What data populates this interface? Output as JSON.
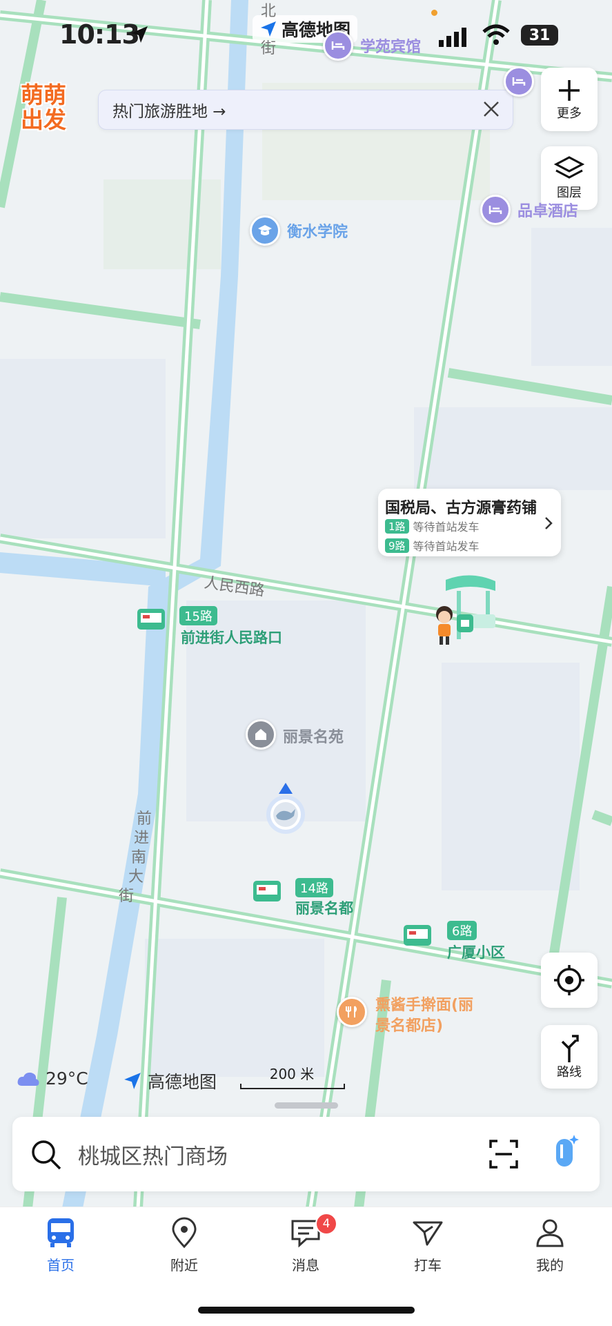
{
  "status_bar": {
    "time": "10:13",
    "app_name": "高德地图",
    "battery": "31"
  },
  "banner": {
    "logo_line1": "萌萌",
    "logo_line2": "出发",
    "text": "热门旅游胜地 →"
  },
  "side_buttons": {
    "more": "更多",
    "layers": "图层",
    "route": "路线"
  },
  "map": {
    "north_label": "北",
    "street_label": "街",
    "pois": [
      {
        "name": "学苑宾馆",
        "color": "#9b8ee0"
      },
      {
        "name": "品卓酒店",
        "color": "#9b8ee0"
      },
      {
        "name": "衡水学院",
        "color": "#6aa3e8"
      },
      {
        "name": "丽景名苑",
        "color": "#8a8f99"
      },
      {
        "name": "熏酱手擀面(丽",
        "color": "#f2a060"
      },
      {
        "name": "景名都店)",
        "color": "#f2a060"
      }
    ],
    "roads": [
      "人民西路",
      "前",
      "进",
      "南",
      "大",
      "街"
    ],
    "bus_stops": [
      {
        "route": "15路",
        "name": "前进街人民路口"
      },
      {
        "route": "14路",
        "name": "丽景名都"
      },
      {
        "route": "6路",
        "name": "广厦小区"
      }
    ],
    "bus_card": {
      "title": "国税局、古方源膏药铺",
      "rows": [
        {
          "route": "1路",
          "status": "等待首站发车"
        },
        {
          "route": "9路",
          "status": "等待首站发车"
        }
      ]
    },
    "weather": "29°C",
    "brand": "高德地图",
    "scale": "200 米"
  },
  "search": {
    "placeholder": "桃城区热门商场"
  },
  "tabs": [
    {
      "label": "首页",
      "active": true
    },
    {
      "label": "附近"
    },
    {
      "label": "消息",
      "badge": "4"
    },
    {
      "label": "打车"
    },
    {
      "label": "我的"
    }
  ]
}
